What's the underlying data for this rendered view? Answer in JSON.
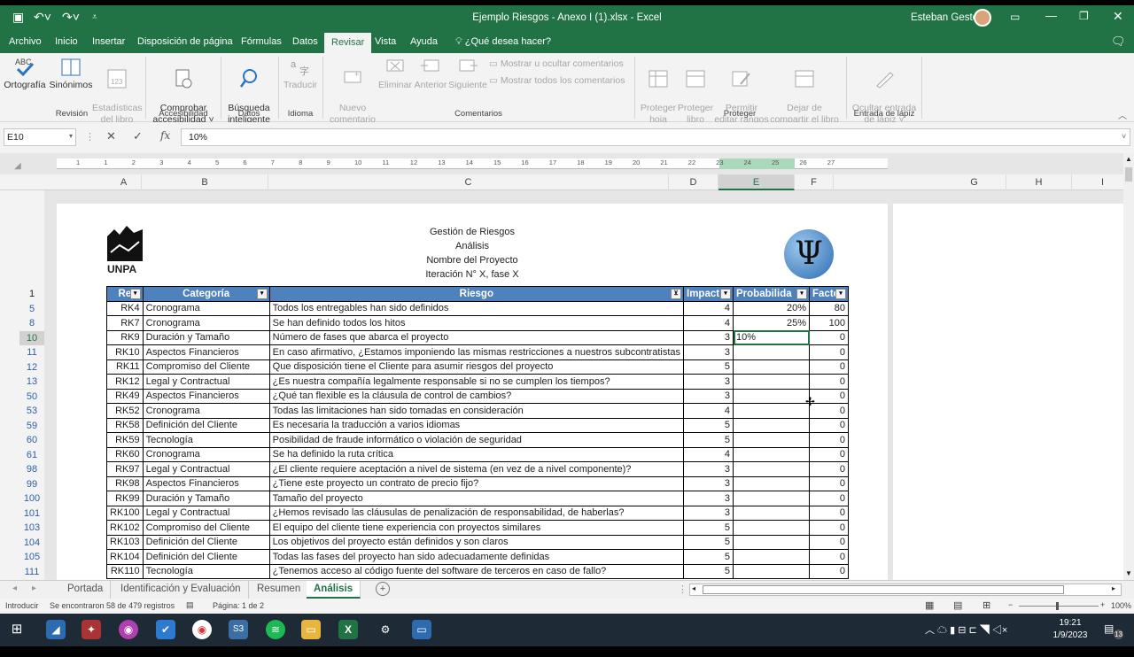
{
  "window": {
    "title": "Ejemplo Riesgos - Anexo I (1).xlsx - Excel",
    "user": "Esteban Gesto"
  },
  "ribbon_tabs": [
    "Archivo",
    "Inicio",
    "Insertar",
    "Disposición de página",
    "Fórmulas",
    "Datos",
    "Revisar",
    "Vista",
    "Ayuda",
    "¿Qué desea hacer?"
  ],
  "ribbon": {
    "ortografia": "Ortografía",
    "sinonimos": "Sinónimos",
    "estadisticas": "Estadísticas\ndel libro",
    "g_revision": "Revisión",
    "comprobar": "Comprobar\naccesibilidad ˅",
    "g_accesibilidad": "Accesibilidad",
    "busqueda": "Búsqueda\ninteligente",
    "g_datos": "Datos",
    "traducir": "Traducir",
    "g_idioma": "Idioma",
    "nuevo": "Nuevo\ncomentario",
    "eliminar": "Eliminar",
    "anterior": "Anterior",
    "siguiente": "Siguiente",
    "mostrar_ocultar": "Mostrar u ocultar comentarios",
    "mostrar_todos": "Mostrar todos los comentarios",
    "g_comentarios": "Comentarios",
    "proteger_hoja": "Proteger\nhoja",
    "proteger_libro": "Proteger\nlibro",
    "permitir": "Permitir\neditar rangos",
    "dejar": "Dejar de\ncompartir el libro",
    "g_proteger": "Proteger",
    "ocultar": "Ocultar entrada\nde lápiz ˅",
    "g_lapiz": "Entrada de lápiz"
  },
  "formula": {
    "namebox": "E10",
    "value": "10%"
  },
  "ruler_ticks": [
    "1",
    "1",
    "2",
    "3",
    "4",
    "5",
    "6",
    "7",
    "8",
    "9",
    "10",
    "11",
    "12",
    "13",
    "14",
    "15",
    "16",
    "17",
    "18",
    "19",
    "20",
    "21",
    "22",
    "23",
    "24",
    "25",
    "26",
    "27"
  ],
  "columns": [
    "A",
    "B",
    "C",
    "D",
    "E",
    "F",
    "G",
    "H",
    "I"
  ],
  "row_numbers": [
    "1",
    "5",
    "8",
    "10",
    "11",
    "12",
    "13",
    "50",
    "53",
    "59",
    "60",
    "61",
    "98",
    "99",
    "100",
    "101",
    "103",
    "104",
    "105",
    "111"
  ],
  "doc_header": [
    "Gestión de Riesgos",
    "Análisis",
    "Nombre del Proyecto",
    "Iteración N° X, fase X"
  ],
  "logo_text": "UNPA",
  "table": {
    "headers": [
      "Re",
      "Categoría",
      "Riesgo",
      "Impact",
      "Probabilida",
      "Facto"
    ],
    "rows": [
      [
        "RK4",
        "Cronograma",
        "Todos los entregables han sido definidos",
        "4",
        "20%",
        "80"
      ],
      [
        "RK7",
        "Cronograma",
        "Se han definido todos los hitos",
        "4",
        "25%",
        "100"
      ],
      [
        "RK9",
        "Duración y Tamaño",
        "Número de fases que abarca el proyecto",
        "3",
        "10%",
        "0"
      ],
      [
        "RK10",
        "Aspectos Financieros",
        "En caso afirmativo, ¿Estamos imponiendo las mismas restricciones a nuestros subcontratistas",
        "3",
        "",
        "0"
      ],
      [
        "RK11",
        "Compromiso del Cliente",
        "Que disposición tiene el Cliente para asumir riesgos del proyecto",
        "5",
        "",
        "0"
      ],
      [
        "RK12",
        "Legal y Contractual",
        "¿Es nuestra compañía legalmente responsable si no se cumplen los tiempos?",
        "3",
        "",
        "0"
      ],
      [
        "RK49",
        "Aspectos Financieros",
        "¿Qué tan flexible es la cláusula de control de cambios?",
        "3",
        "",
        "0"
      ],
      [
        "RK52",
        "Cronograma",
        "Todas las limitaciones han sido tomadas en consideración",
        "4",
        "",
        "0"
      ],
      [
        "RK58",
        "Definición del Cliente",
        "Es necesaria la traducción a varios idiomas",
        "5",
        "",
        "0"
      ],
      [
        "RK59",
        "Tecnología",
        "Posibilidad de fraude informático o violación de seguridad",
        "5",
        "",
        "0"
      ],
      [
        "RK60",
        "Cronograma",
        "Se ha definido la ruta crítica",
        "4",
        "",
        "0"
      ],
      [
        "RK97",
        "Legal y Contractual",
        "¿El cliente requiere aceptación a nivel de sistema (en vez de a nivel componente)?",
        "3",
        "",
        "0"
      ],
      [
        "RK98",
        "Aspectos Financieros",
        "¿Tiene este proyecto un contrato de precio fijo?",
        "3",
        "",
        "0"
      ],
      [
        "RK99",
        "Duración y Tamaño",
        "Tamaño del proyecto",
        "3",
        "",
        "0"
      ],
      [
        "RK100",
        "Legal y Contractual",
        "¿Hemos revisado las cláusulas de penalización de responsabilidad, de haberlas?",
        "3",
        "",
        "0"
      ],
      [
        "RK102",
        "Compromiso del Cliente",
        "El equipo del cliente tiene experiencia con proyectos similares",
        "5",
        "",
        "0"
      ],
      [
        "RK103",
        "Definición del Cliente",
        "Los objetivos del proyecto están definidos y son claros",
        "5",
        "",
        "0"
      ],
      [
        "RK104",
        "Definición del Cliente",
        "Todas las fases del proyecto han sido adecuadamente definidas",
        "5",
        "",
        "0"
      ],
      [
        "RK110",
        "Tecnología",
        "¿Tenemos acceso al código fuente del software de terceros en caso de fallo?",
        "5",
        "",
        "0"
      ]
    ]
  },
  "sheet_tabs": [
    "Portada",
    "Identificación y Evaluación",
    "Resumen",
    "Análisis"
  ],
  "status": {
    "mode": "Introducir",
    "found": "Se encontraron 58 de 479 registros",
    "page": "Página: 1 de 2",
    "zoom": "100%"
  },
  "taskbar": {
    "time": "19:21",
    "date": "1/9/2023",
    "notif": "13"
  },
  "colors": {
    "excel_green": "#217346",
    "table_header": "#4f81bd"
  }
}
